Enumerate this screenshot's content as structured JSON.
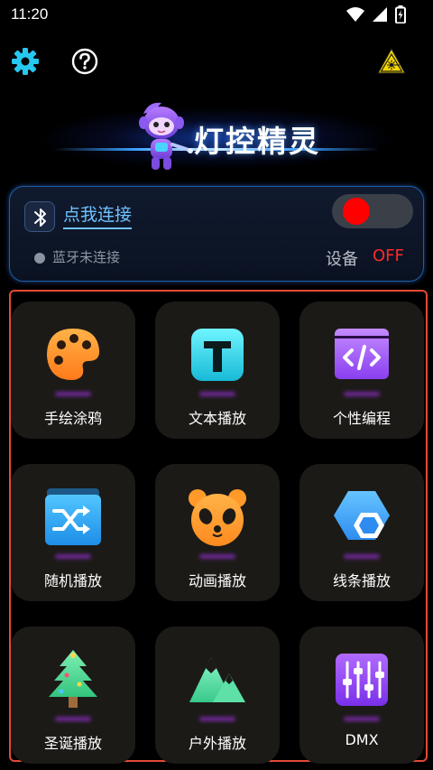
{
  "status_bar": {
    "time": "11:20"
  },
  "app": {
    "title": "灯控精灵"
  },
  "connection": {
    "connect_label": "点我连接",
    "bluetooth_status": "蓝牙未连接",
    "device_label": "设备",
    "device_state": "OFF",
    "toggle_on": false
  },
  "features": [
    {
      "label": "手绘涂鸦",
      "icon": "palette-icon"
    },
    {
      "label": "文本播放",
      "icon": "text-t-icon"
    },
    {
      "label": "个性编程",
      "icon": "code-window-icon"
    },
    {
      "label": "随机播放",
      "icon": "shuffle-icon"
    },
    {
      "label": "动画播放",
      "icon": "panda-icon"
    },
    {
      "label": "线条播放",
      "icon": "hexagon-icon"
    },
    {
      "label": "圣诞播放",
      "icon": "christmas-tree-icon"
    },
    {
      "label": "户外播放",
      "icon": "mountain-icon"
    },
    {
      "label": "DMX",
      "icon": "sliders-icon"
    }
  ],
  "colors": {
    "accent_link": "#6fc2ff",
    "off_state": "#ff2a2a",
    "toggle_knob": "#ff0000",
    "highlight_border": "#e54a36",
    "tile_bg": "#1c1a17"
  }
}
